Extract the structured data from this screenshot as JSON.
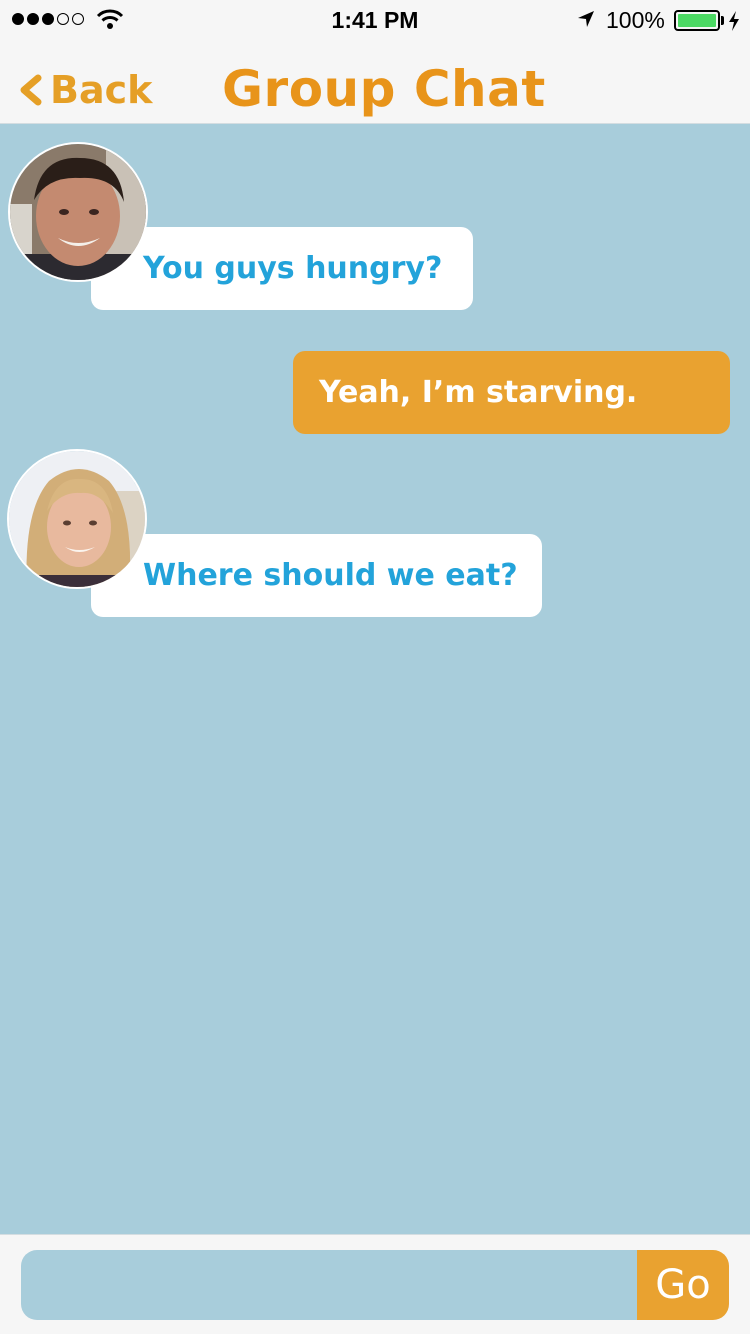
{
  "status_bar": {
    "time": "1:41 PM",
    "battery_percent": "100%",
    "signal_bars_filled": 3,
    "signal_bars_total": 5
  },
  "nav": {
    "back_label": "Back",
    "title": "Group Chat"
  },
  "messages": [
    {
      "direction": "incoming",
      "text": "You guys hungry?",
      "avatar": "avatar-boy"
    },
    {
      "direction": "outgoing",
      "text": "Yeah, I’m starving."
    },
    {
      "direction": "incoming",
      "text": "Where should we eat?",
      "avatar": "avatar-girl"
    }
  ],
  "composer": {
    "placeholder": "",
    "go_label": "Go"
  },
  "colors": {
    "accent": "#e8941a",
    "chat_background": "#a8cddb",
    "incoming_text": "#23a3da",
    "outgoing_bubble": "#e9a230"
  }
}
